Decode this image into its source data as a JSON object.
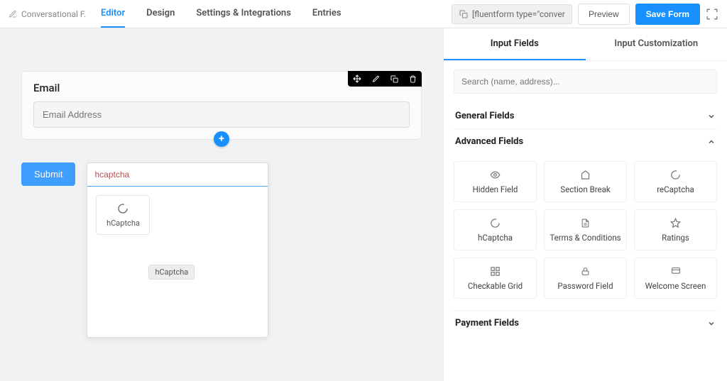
{
  "brand": "Conversational F...",
  "tabs": {
    "editor": "Editor",
    "design": "Design",
    "settings": "Settings & Integrations",
    "entries": "Entries"
  },
  "shortcode": "[fluentform type=\"conver",
  "buttons": {
    "preview": "Preview",
    "save": "Save Form"
  },
  "editor": {
    "field_label": "Email",
    "field_placeholder": "Email Address",
    "submit": "Submit",
    "search_value": "hcaptcha",
    "result_label": "hCaptcha",
    "tooltip": "hCaptcha"
  },
  "sidebar": {
    "tab_fields": "Input Fields",
    "tab_customization": "Input Customization",
    "search_placeholder": "Search (name, address)...",
    "sections": {
      "general": "General Fields",
      "advanced": "Advanced Fields",
      "payment": "Payment Fields"
    },
    "advanced_items": [
      "Hidden Field",
      "Section Break",
      "reCaptcha",
      "hCaptcha",
      "Terms & Conditions",
      "Ratings",
      "Checkable Grid",
      "Password Field",
      "Welcome Screen"
    ]
  }
}
